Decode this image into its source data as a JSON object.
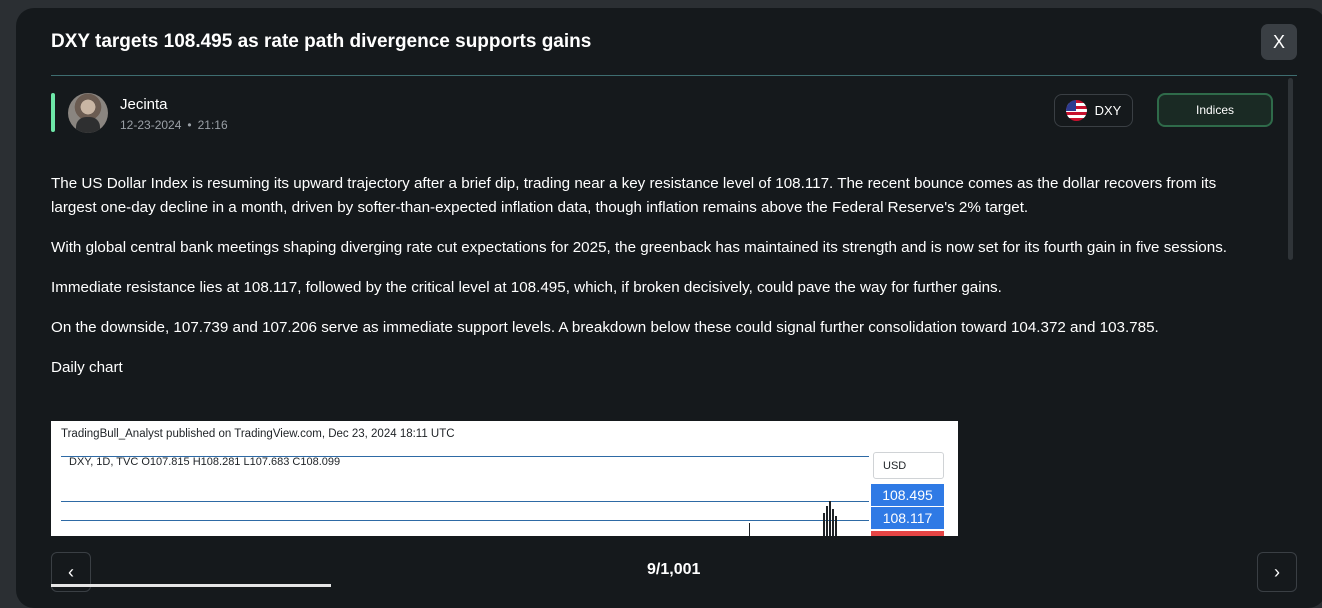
{
  "modal": {
    "title": "DXY targets 108.495 as rate path divergence supports gains",
    "close_label": "X"
  },
  "author": {
    "name": "Jecinta",
    "date": "12-23-2024",
    "separator": "•",
    "time": "21:16"
  },
  "tags": {
    "symbol": "DXY",
    "category": "Indices"
  },
  "article": {
    "paragraphs": [
      "The US Dollar Index is resuming its upward trajectory after a brief dip, trading near a key resistance level of 108.117. The recent bounce comes as the dollar recovers from its largest one-day decline in a month, driven by softer-than-expected inflation data, though inflation remains above the Federal Reserve's 2% target.",
      "With global central bank meetings shaping diverging rate cut expectations for 2025, the greenback has maintained its strength and is now set for its fourth gain in five sessions.",
      "Immediate resistance lies at 108.117, followed by the critical level at 108.495, which, if broken decisively, could pave the way for further gains.",
      "On the downside, 107.739 and 107.206 serve as immediate support levels. A breakdown below these could signal further consolidation toward 104.372 and 103.785.",
      "Daily chart"
    ]
  },
  "chart": {
    "header": "TradingBull_Analyst published on TradingView.com, Dec 23, 2024 18:11 UTC",
    "ohlc": "DXY, 1D, TVC  O107.815  H108.281  L107.683  C108.099",
    "currency": "USD",
    "price_tags": [
      "108.495",
      "108.117"
    ],
    "tag_color": "#2f7ae5"
  },
  "pagination": {
    "current": "9/1,001",
    "prev_icon": "chevron-left-icon",
    "next_icon": "chevron-right-icon"
  },
  "colors": {
    "accent_green": "#6ee7a8",
    "background": "#15191c"
  }
}
